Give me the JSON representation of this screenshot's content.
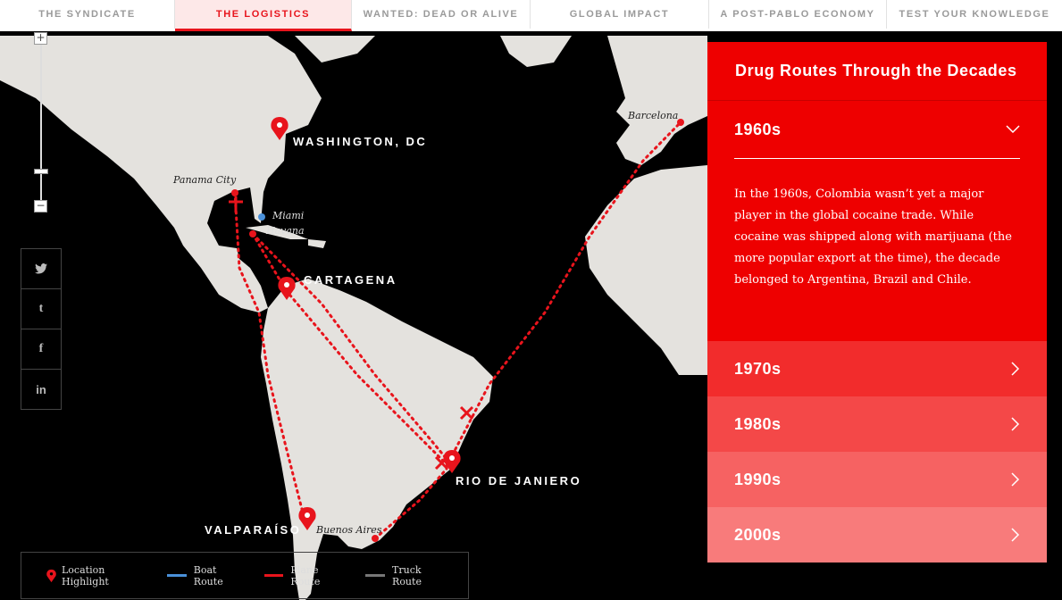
{
  "nav": {
    "tabs": [
      {
        "label": "THE SYNDICATE",
        "active": false
      },
      {
        "label": "THE LOGISTICS",
        "active": true
      },
      {
        "label": "WANTED: DEAD OR ALIVE",
        "active": false
      },
      {
        "label": "GLOBAL IMPACT",
        "active": false
      },
      {
        "label": "A POST-PABLO ECONOMY",
        "active": false
      },
      {
        "label": "TEST YOUR KNOWLEDGE",
        "active": false
      }
    ]
  },
  "map": {
    "cities": {
      "barcelona": "Barcelona",
      "panama_city": "Panama City",
      "miami": "Miami",
      "havana": "Havana",
      "buenos_aires": "Buenos Aires"
    },
    "highlights": {
      "washington": "WASHINGTON, DC",
      "cartagena": "CARTAGENA",
      "rio": "RIO DE JANIERO",
      "valparaiso": "VALPARAÍSO"
    },
    "zoom": {
      "in": "+",
      "out": "−"
    }
  },
  "social": {
    "icons": [
      "twitter-icon",
      "tumblr-icon",
      "facebook-icon",
      "linkedin-icon"
    ],
    "glyphs": [
      "t",
      "t",
      "f",
      "in"
    ]
  },
  "legend": {
    "location": "Location Highlight",
    "boat": "Boat Route",
    "plane": "Plane Route",
    "truck": "Truck Route",
    "colors": {
      "location": "#e8141c",
      "boat": "#4a90d9",
      "plane": "#e8141c",
      "truck": "#777777"
    }
  },
  "panel": {
    "title": "Drug Routes Through the Decades",
    "open_decade": {
      "label": "1960s",
      "text": "In the 1960s, Colombia wasn’t yet a major player in the global cocaine trade. While cocaine was shipped along with marijuana (the more popular export at the time), the decade belonged to Argentina, Brazil and Chile."
    },
    "decades": [
      {
        "label": "1970s",
        "color": "#f22c2c"
      },
      {
        "label": "1980s",
        "color": "#f44848"
      },
      {
        "label": "1990s",
        "color": "#f66262"
      },
      {
        "label": "2000s",
        "color": "#f87b7b"
      }
    ]
  }
}
